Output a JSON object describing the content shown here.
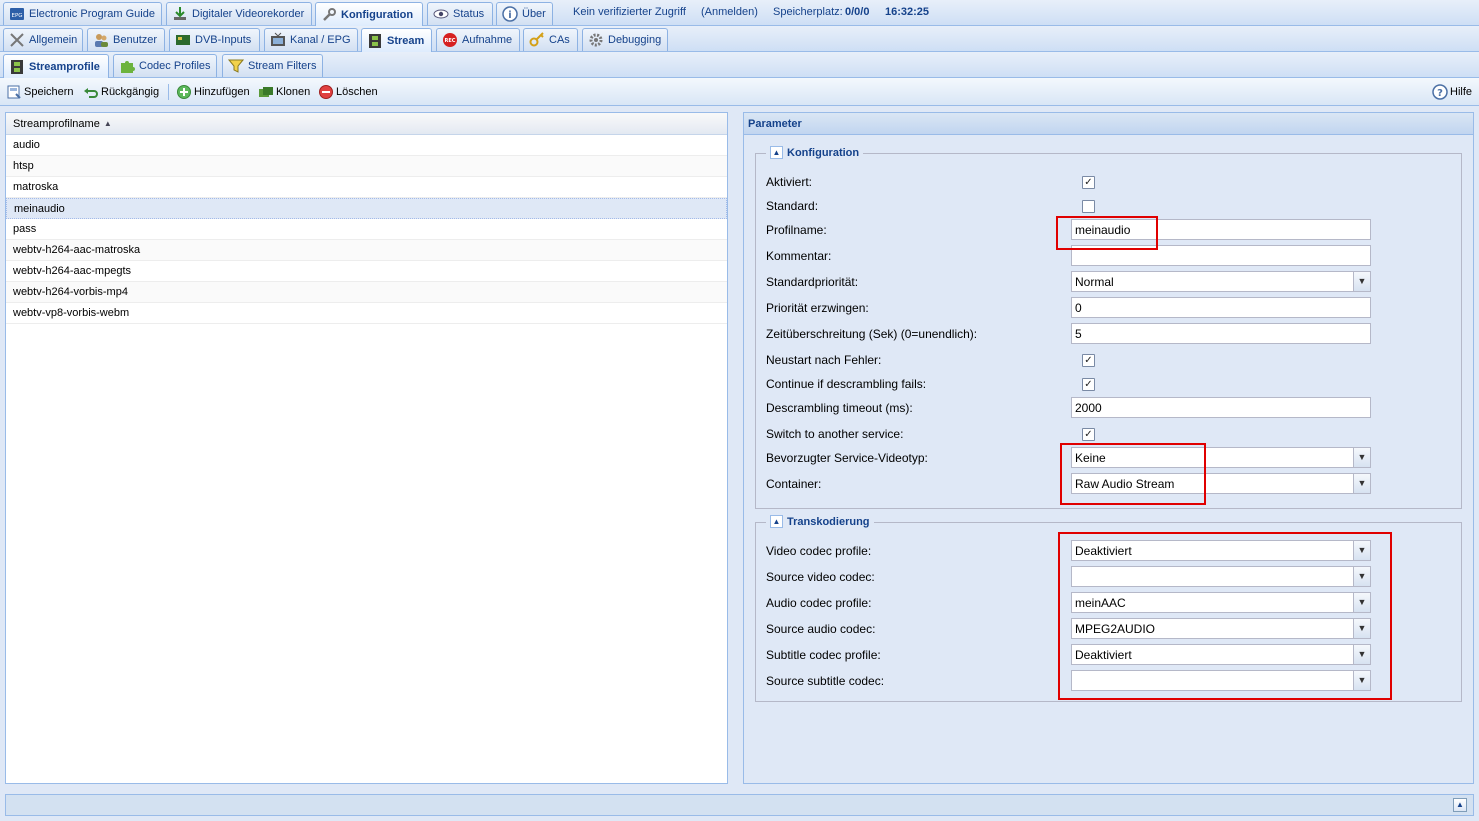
{
  "top_tabs": [
    {
      "label": "Electronic Program Guide",
      "icon": "epg-icon"
    },
    {
      "label": "Digitaler Videorekorder",
      "icon": "download-icon"
    },
    {
      "label": "Konfiguration",
      "icon": "wrench-icon"
    },
    {
      "label": "Status",
      "icon": "eye-icon"
    },
    {
      "label": "Über",
      "icon": "info-icon"
    }
  ],
  "status": {
    "access": "Kein verifizierter Zugriff",
    "login": "(Anmelden)",
    "storage_label": "Speicherplatz:",
    "storage_value": "0/0/0",
    "time": "16:32:25"
  },
  "config_tabs": [
    {
      "label": "Allgemein",
      "icon": "tools-icon"
    },
    {
      "label": "Benutzer",
      "icon": "users-icon"
    },
    {
      "label": "DVB-Inputs",
      "icon": "card-icon"
    },
    {
      "label": "Kanal / EPG",
      "icon": "tv-icon"
    },
    {
      "label": "Stream",
      "icon": "film-icon"
    },
    {
      "label": "Aufnahme",
      "icon": "rec-icon"
    },
    {
      "label": "CAs",
      "icon": "key-icon"
    },
    {
      "label": "Debugging",
      "icon": "gear-icon"
    }
  ],
  "stream_tabs": [
    {
      "label": "Streamprofile",
      "icon": "film-icon"
    },
    {
      "label": "Codec Profiles",
      "icon": "puzzle-icon"
    },
    {
      "label": "Stream Filters",
      "icon": "filter-icon"
    }
  ],
  "toolbar": {
    "save": "Speichern",
    "undo": "Rückgängig",
    "add": "Hinzufügen",
    "clone": "Klonen",
    "delete": "Löschen",
    "help": "Hilfe"
  },
  "grid": {
    "header": "Streamprofilname",
    "rows": [
      "audio",
      "htsp",
      "matroska",
      "meinaudio",
      "pass",
      "webtv-h264-aac-matroska",
      "webtv-h264-aac-mpegts",
      "webtv-h264-vorbis-mp4",
      "webtv-vp8-vorbis-webm"
    ],
    "selected": "meinaudio"
  },
  "panel": {
    "title": "Parameter",
    "konfiguration": {
      "legend": "Konfiguration",
      "aktiviert_label": "Aktiviert:",
      "aktiviert": true,
      "standard_label": "Standard:",
      "standard": false,
      "profilname_label": "Profilname:",
      "profilname": "meinaudio",
      "kommentar_label": "Kommentar:",
      "kommentar": "",
      "prioritaet_label": "Standardpriorität:",
      "prioritaet": "Normal",
      "prio_erzwingen_label": "Priorität erzwingen:",
      "prio_erzwingen": "0",
      "timeout_label": "Zeitüberschreitung (Sek) (0=unendlich):",
      "timeout": "5",
      "neustart_label": "Neustart nach Fehler:",
      "neustart": true,
      "continue_label": "Continue if descrambling fails:",
      "continue": true,
      "descr_timeout_label": "Descrambling timeout (ms):",
      "descr_timeout": "2000",
      "switch_label": "Switch to another service:",
      "switch": true,
      "videotyp_label": "Bevorzugter Service-Videotyp:",
      "videotyp": "Keine",
      "container_label": "Container:",
      "container": "Raw Audio Stream"
    },
    "transkodierung": {
      "legend": "Transkodierung",
      "video_profile_label": "Video codec profile:",
      "video_profile": "Deaktiviert",
      "source_video_label": "Source video codec:",
      "source_video": "",
      "audio_profile_label": "Audio codec profile:",
      "audio_profile": "meinAAC",
      "source_audio_label": "Source audio codec:",
      "source_audio": "MPEG2AUDIO",
      "subtitle_profile_label": "Subtitle codec profile:",
      "subtitle_profile": "Deaktiviert",
      "source_subtitle_label": "Source subtitle codec:",
      "source_subtitle": ""
    }
  },
  "colors": {
    "highlight_box": "#e00000",
    "accent": "#15428b",
    "background": "#dfe8f6"
  }
}
